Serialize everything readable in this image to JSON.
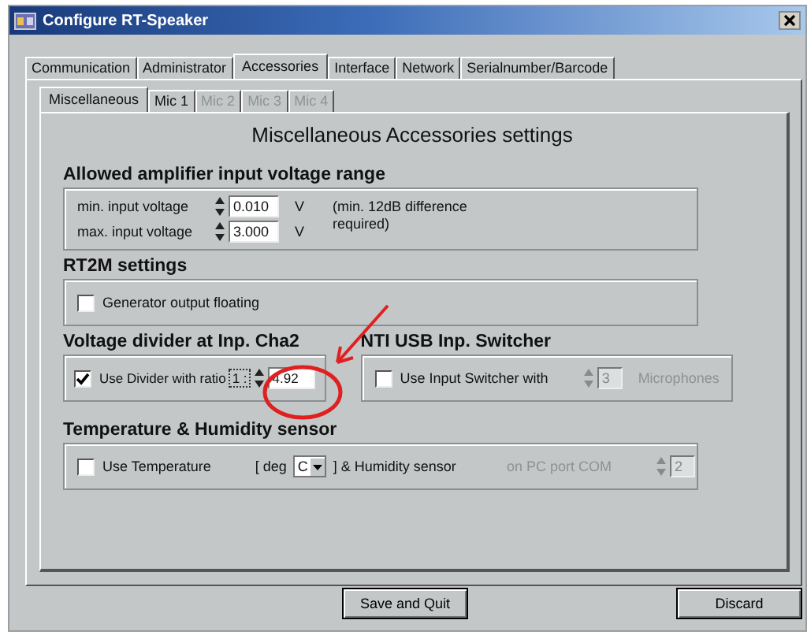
{
  "window": {
    "title": "Configure RT-Speaker"
  },
  "tabs": [
    {
      "label": "Communication",
      "selected": false
    },
    {
      "label": "Administrator",
      "selected": false
    },
    {
      "label": "Accessories",
      "selected": true
    },
    {
      "label": "Interface",
      "selected": false
    },
    {
      "label": "Network",
      "selected": false
    },
    {
      "label": "Serialnumber/Barcode",
      "selected": false
    }
  ],
  "subtabs": [
    {
      "label": "Miscellaneous",
      "selected": true,
      "disabled": false
    },
    {
      "label": "Mic 1",
      "selected": false,
      "disabled": false
    },
    {
      "label": "Mic 2",
      "selected": false,
      "disabled": true
    },
    {
      "label": "Mic 3",
      "selected": false,
      "disabled": true
    },
    {
      "label": "Mic 4",
      "selected": false,
      "disabled": true
    }
  ],
  "heading": "Miscellaneous Accessories settings",
  "amplifier_range": {
    "title": "Allowed amplifier input voltage range",
    "rows": [
      {
        "label": "min. input voltage",
        "value": "0.010",
        "unit": "V"
      },
      {
        "label": "max. input voltage",
        "value": "3.000",
        "unit": "V"
      }
    ],
    "note": "(min. 12dB difference required)"
  },
  "rt2m": {
    "title": "RT2M settings",
    "checkbox": {
      "label": "Generator output floating",
      "checked": false
    }
  },
  "voltage_divider": {
    "title": "Voltage divider at Inp. Cha2",
    "checkbox": {
      "label": "Use Divider with ratio",
      "checked": true
    },
    "ratio": "1 :",
    "value": "4.92"
  },
  "usb_switcher": {
    "title": "NTI USB Inp. Switcher",
    "checkbox": {
      "label": "Use Input Switcher with",
      "checked": false
    },
    "count": "3",
    "unit": "Microphones",
    "disabled": true
  },
  "temperature": {
    "title": "Temperature & Humidity sensor",
    "checkbox": {
      "label": "Use Temperature",
      "checked": false
    },
    "unit_prefix": "[ deg",
    "unit": "C",
    "unit_suffix": "] & Humidity sensor",
    "port_label": "on PC port COM",
    "port": "2",
    "port_disabled": true
  },
  "buttons": [
    {
      "label": "Save and Quit"
    },
    {
      "label": "Discard"
    }
  ]
}
